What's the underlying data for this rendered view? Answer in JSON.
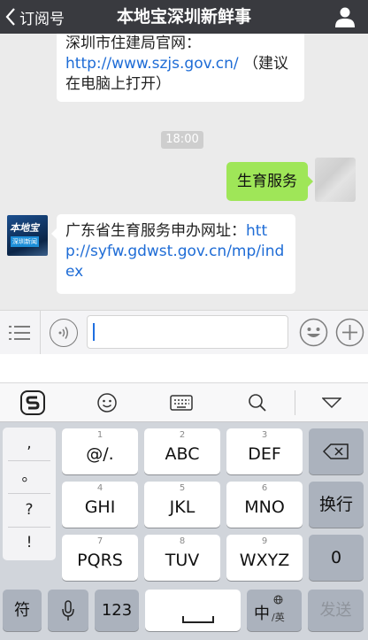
{
  "header": {
    "back_label": "订阅号",
    "title": "本地宝深圳新鲜事"
  },
  "chat": {
    "msg_top": {
      "text1": "深圳市住建局官网：",
      "link": "http://www.szjs.gov.cn/",
      "text2": "（建议在电脑上打开）"
    },
    "timestamp": "18:00",
    "sent_msg": "生育服务",
    "bot_avatar": {
      "line1": "本地宝",
      "line2": "深圳新闻"
    },
    "msg_bottom": {
      "text": "广东省生育服务申办网址：",
      "link": "http://syfw.gdwst.gov.cn/mp/index"
    }
  },
  "keyboard": {
    "side_keys": [
      ",",
      "。",
      "?",
      "!"
    ],
    "rows": [
      [
        {
          "num": "1",
          "label": "@/."
        },
        {
          "num": "2",
          "label": "ABC"
        },
        {
          "num": "3",
          "label": "DEF"
        }
      ],
      [
        {
          "num": "4",
          "label": "GHI"
        },
        {
          "num": "5",
          "label": "JKL"
        },
        {
          "num": "6",
          "label": "MNO"
        }
      ],
      [
        {
          "num": "7",
          "label": "PQRS"
        },
        {
          "num": "8",
          "label": "TUV"
        },
        {
          "num": "9",
          "label": "WXYZ"
        }
      ]
    ],
    "newline": "换行",
    "zero": "0",
    "symbols": "符",
    "num_mode": "123",
    "lang_main": "中",
    "lang_sub": "/英",
    "send": "发送"
  },
  "colors": {
    "header_bg": "#393a3f",
    "sent_bubble": "#9fe658",
    "link": "#1e6cd6",
    "keyboard_bg": "#d1d5db"
  }
}
